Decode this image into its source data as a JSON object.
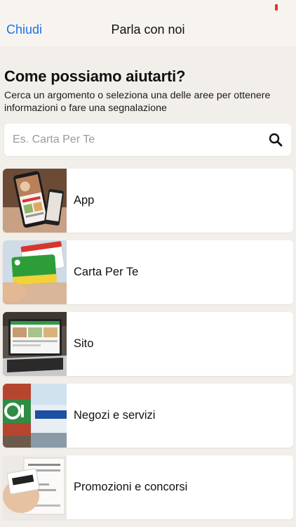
{
  "nav": {
    "close_label": "Chiudi",
    "title": "Parla con noi"
  },
  "intro": {
    "heading": "Come possiamo aiutarti?",
    "subheading": "Cerca un argomento o seleziona una delle aree per ottenere informazioni o fare una segnalazione"
  },
  "search": {
    "placeholder": "Es. Carta Per Te",
    "value": "",
    "icon": "search-icon"
  },
  "topics": [
    {
      "label": "App"
    },
    {
      "label": "Carta Per Te"
    },
    {
      "label": "Sito"
    },
    {
      "label": "Negozi e servizi"
    },
    {
      "label": "Promozioni e concorsi"
    }
  ],
  "colors": {
    "accent": "#1a73e8",
    "background": "#f2efeb",
    "header_background": "#f7f4f0",
    "card_background": "#ffffff",
    "battery": "#e5342f"
  }
}
